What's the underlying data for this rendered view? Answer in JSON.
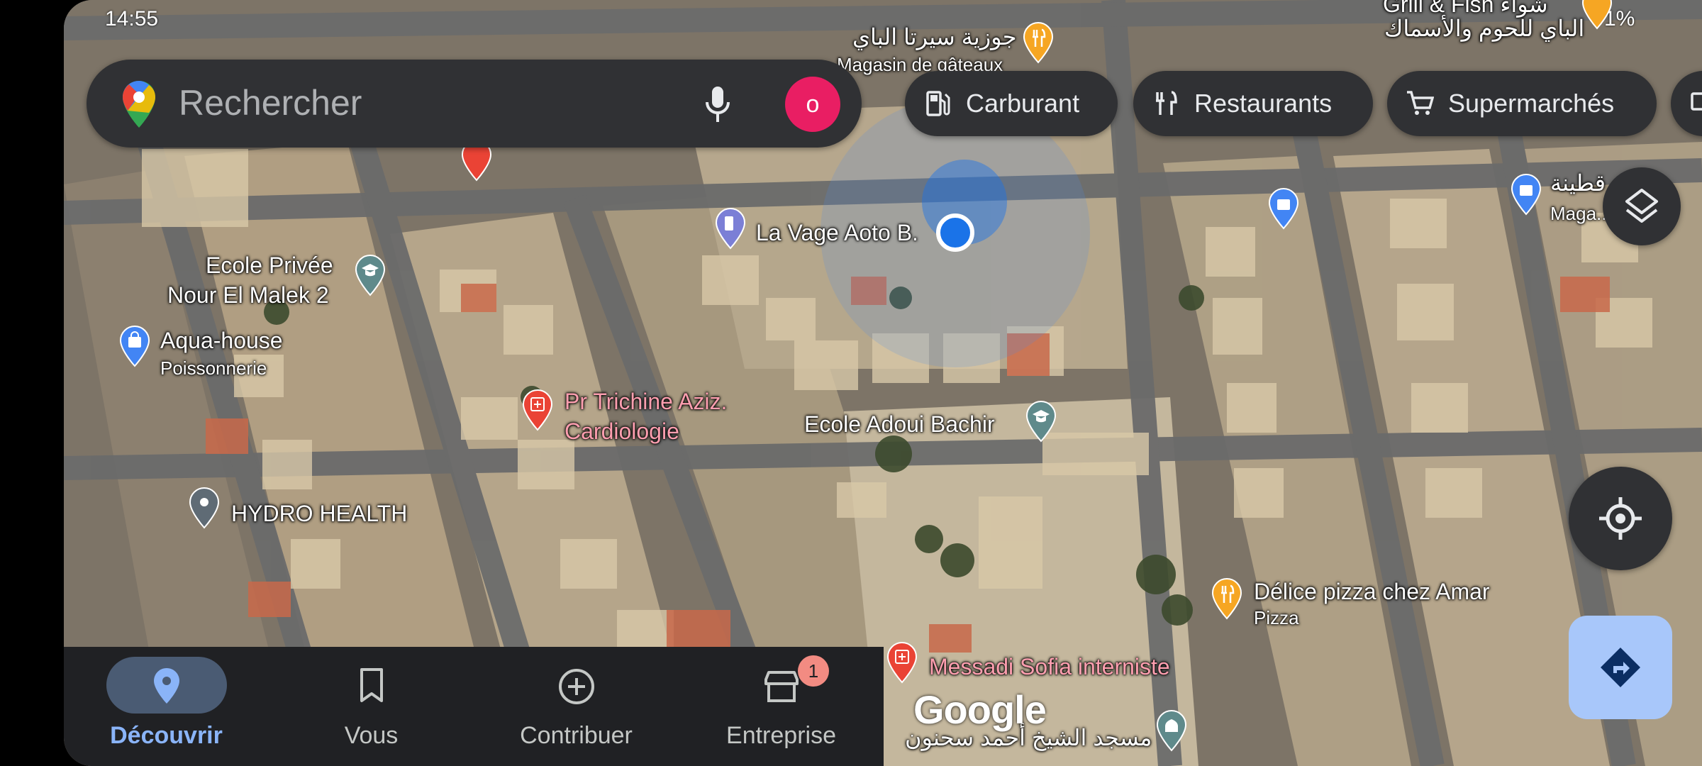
{
  "status_bar": {
    "time": "14:55",
    "battery": "1%"
  },
  "search": {
    "placeholder": "Rechercher",
    "avatar_letter": "o"
  },
  "chips": [
    {
      "label": "Carburant",
      "icon": "gas-station-icon"
    },
    {
      "label": "Restaurants",
      "icon": "restaurant-icon"
    },
    {
      "label": "Supermarchés",
      "icon": "cart-icon"
    }
  ],
  "pois": {
    "top_restaurant": {
      "name": "جوزية سيرتا الباي",
      "sub": "Magasin de gâteaux"
    },
    "top_right_fish": {
      "name1": "Grill & Fish شواء",
      "name2": "الباي للحوم والأسماك"
    },
    "ecole_privee": {
      "line1": "Ecole Privée",
      "line2": "Nour El Malek 2"
    },
    "aqua_house": {
      "name": "Aqua-house",
      "sub": "Poissonnerie"
    },
    "la_vage": {
      "name": "La Vage Aoto B."
    },
    "trichine": {
      "line1": "Pr Trichine Aziz.",
      "line2": "Cardiologie"
    },
    "ecole_adoui": {
      "name": "Ecole Adoui Bachir"
    },
    "hydro": {
      "name": "HYDRO HEALTH"
    },
    "delice": {
      "name": "Délice pizza chez Amar",
      "sub": "Pizza"
    },
    "messadi": {
      "name": "Messadi Sofia interniste"
    },
    "mosque": {
      "name": "مسجد الشيخ أحمد سحنون"
    },
    "right_store": {
      "name": "قطينة",
      "sub": "Maga...ête"
    }
  },
  "bottom_nav": [
    {
      "label": "Découvrir",
      "icon": "pin-icon",
      "active": true
    },
    {
      "label": "Vous",
      "icon": "bookmark-icon",
      "active": false
    },
    {
      "label": "Contribuer",
      "icon": "add-circle-icon",
      "active": false
    },
    {
      "label": "Entreprise",
      "icon": "store-icon",
      "active": false,
      "badge": "1"
    }
  ],
  "map_logo": "Google",
  "colors": {
    "nav_active": "#8ab4f8",
    "avatar": "#e91e63",
    "directions": "#a8c7fa",
    "location_dot": "#1a73e8"
  }
}
